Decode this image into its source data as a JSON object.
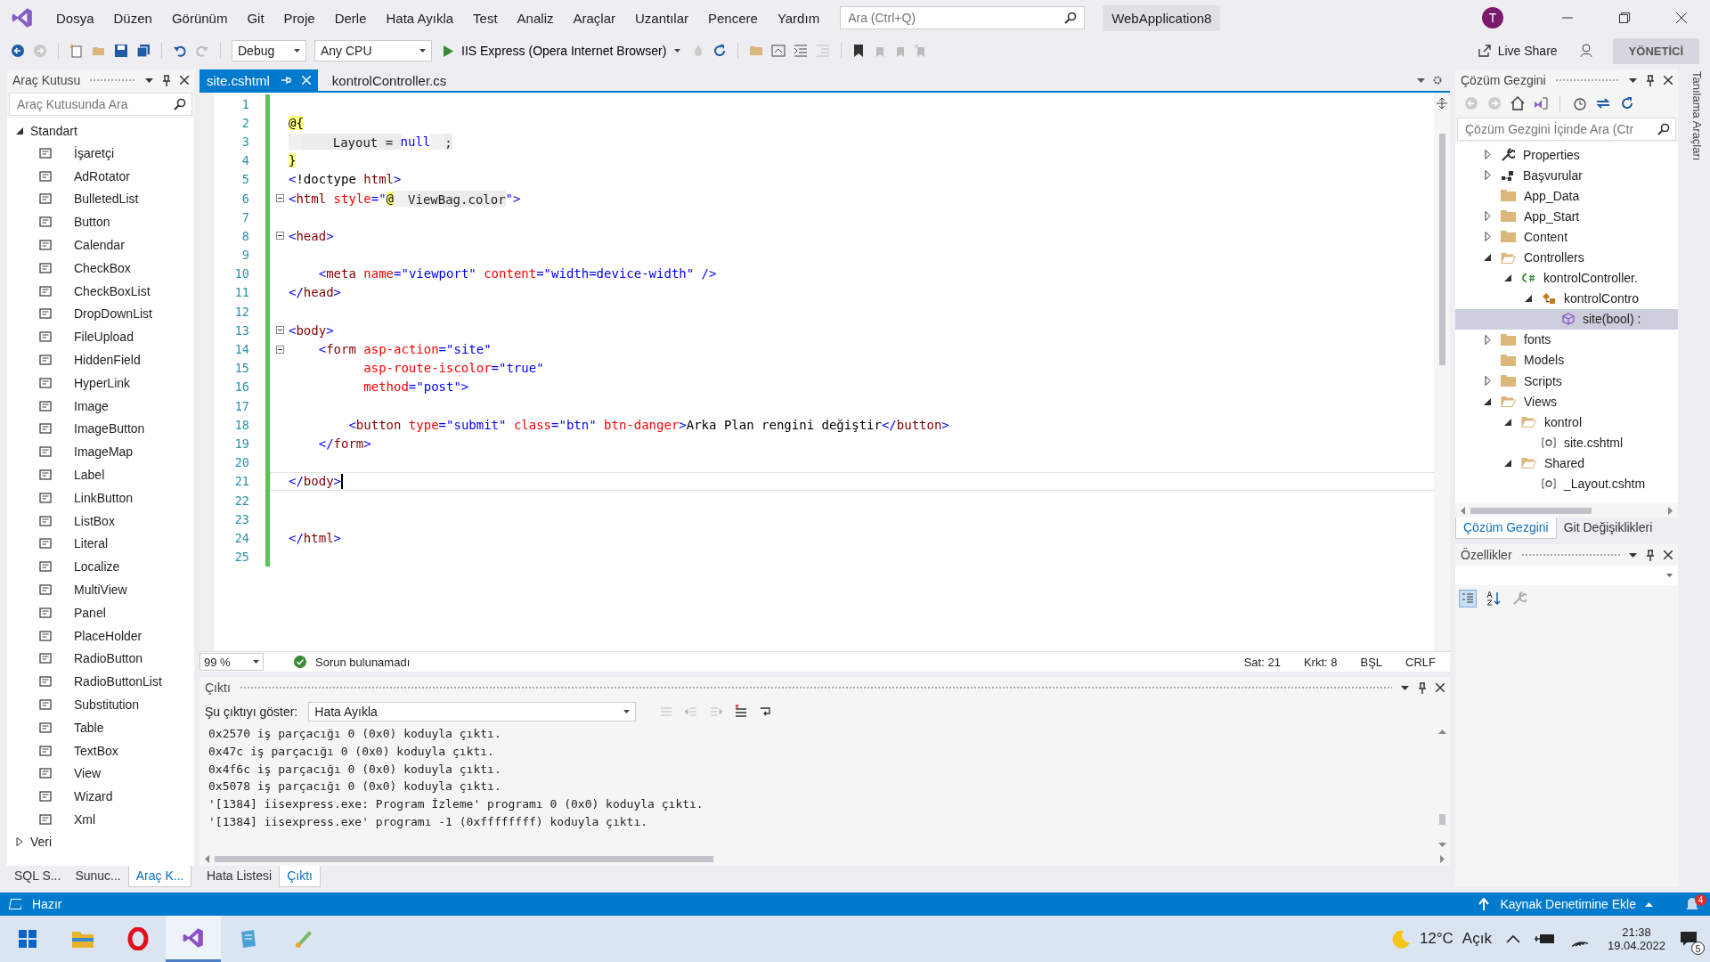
{
  "menu": [
    "Dosya",
    "Düzen",
    "Görünüm",
    "Git",
    "Proje",
    "Derle",
    "Hata Ayıkla",
    "Test",
    "Analiz",
    "Araçlar",
    "Uzantılar",
    "Pencere",
    "Yardım"
  ],
  "search": {
    "placeholder": "Ara (Ctrl+Q)"
  },
  "solution_name": "WebApplication8",
  "avatar": "T",
  "toolbar": {
    "configuration": "Debug",
    "platform": "Any CPU",
    "run": "IIS Express (Opera Internet Browser)",
    "live_share": "Live Share",
    "role": "YÖNETİCİ"
  },
  "toolbox": {
    "title": "Araç Kutusu",
    "placeholder": "Araç Kutusunda Ara",
    "groups": [
      {
        "label": "Standart",
        "expanded": true,
        "items": [
          "İşaretçi",
          "AdRotator",
          "BulletedList",
          "Button",
          "Calendar",
          "CheckBox",
          "CheckBoxList",
          "DropDownList",
          "FileUpload",
          "HiddenField",
          "HyperLink",
          "Image",
          "ImageButton",
          "ImageMap",
          "Label",
          "LinkButton",
          "ListBox",
          "Literal",
          "Localize",
          "MultiView",
          "Panel",
          "PlaceHolder",
          "RadioButton",
          "RadioButtonList",
          "Substitution",
          "Table",
          "TextBox",
          "View",
          "Wizard",
          "Xml"
        ]
      },
      {
        "label": "Veri",
        "expanded": false
      }
    ],
    "tabs": [
      {
        "label": "SQL S...",
        "selected": false
      },
      {
        "label": "Sunuc...",
        "selected": false
      },
      {
        "label": "Araç K...",
        "selected": true
      }
    ]
  },
  "editor": {
    "tabs": [
      {
        "label": "site.cshtml",
        "selected": true
      },
      {
        "label": "kontrolController.cs",
        "selected": false
      }
    ],
    "lines": [
      {
        "number": "1",
        "collapsible": false,
        "current": false
      },
      {
        "number": "2",
        "collapsible": false,
        "current": false,
        "tokens": [
          {
            "kind": "razor",
            "text": "@{"
          }
        ]
      },
      {
        "number": "3",
        "collapsible": false,
        "current": false,
        "tokens": [
          {
            "kind": "code",
            "text": "    Layout = "
          },
          {
            "kind": "keyword",
            "text": "null"
          },
          {
            "kind": "code",
            "text": ";"
          }
        ]
      },
      {
        "number": "4",
        "collapsible": false,
        "current": false,
        "tokens": [
          {
            "kind": "razor",
            "text": "}"
          }
        ]
      },
      {
        "number": "5",
        "collapsible": false,
        "current": false,
        "tokens": [
          {
            "kind": "punct",
            "text": "<"
          },
          {
            "kind": "plain",
            "text": "!doctype "
          },
          {
            "kind": "element",
            "text": "html"
          },
          {
            "kind": "punct",
            "text": ">"
          }
        ]
      },
      {
        "number": "6",
        "collapsible": true,
        "current": false,
        "tokens": [
          {
            "kind": "punct",
            "text": "<"
          },
          {
            "kind": "element",
            "text": "html"
          },
          {
            "kind": "attr",
            "text": " style"
          },
          {
            "kind": "punct",
            "text": "=\""
          },
          {
            "kind": "razor",
            "text": "@"
          },
          {
            "kind": "code",
            "text": "ViewBag.color"
          },
          {
            "kind": "punct",
            "text": "\">"
          }
        ]
      },
      {
        "number": "7",
        "collapsible": false,
        "current": false
      },
      {
        "number": "8",
        "collapsible": true,
        "current": false,
        "tokens": [
          {
            "kind": "punct",
            "text": "<"
          },
          {
            "kind": "element",
            "text": "head"
          },
          {
            "kind": "punct",
            "text": ">"
          }
        ]
      },
      {
        "number": "9",
        "collapsible": false,
        "current": false
      },
      {
        "number": "10",
        "collapsible": false,
        "current": false,
        "tokens": [
          {
            "kind": "punct",
            "text": "    <"
          },
          {
            "kind": "element",
            "text": "meta"
          },
          {
            "kind": "attr",
            "text": " name"
          },
          {
            "kind": "punct",
            "text": "=\"viewport\""
          },
          {
            "kind": "attr",
            "text": " content"
          },
          {
            "kind": "punct",
            "text": "=\"width=device-width\" />"
          }
        ]
      },
      {
        "number": "11",
        "collapsible": false,
        "current": false,
        "tokens": [
          {
            "kind": "punct",
            "text": "</"
          },
          {
            "kind": "element",
            "text": "head"
          },
          {
            "kind": "punct",
            "text": ">"
          }
        ]
      },
      {
        "number": "12",
        "collapsible": false,
        "current": false
      },
      {
        "number": "13",
        "collapsible": true,
        "current": false,
        "tokens": [
          {
            "kind": "punct",
            "text": "<"
          },
          {
            "kind": "element",
            "text": "body"
          },
          {
            "kind": "punct",
            "text": ">"
          }
        ]
      },
      {
        "number": "14",
        "collapsible": true,
        "current": false,
        "tokens": [
          {
            "kind": "punct",
            "text": "    <"
          },
          {
            "kind": "element",
            "text": "form"
          },
          {
            "kind": "attr",
            "text": " asp-action"
          },
          {
            "kind": "punct",
            "text": "=\"site\""
          }
        ]
      },
      {
        "number": "15",
        "collapsible": false,
        "current": false,
        "tokens": [
          {
            "kind": "attr",
            "text": "          asp-route-iscolor"
          },
          {
            "kind": "punct",
            "text": "=\"true\""
          }
        ]
      },
      {
        "number": "16",
        "collapsible": false,
        "current": false,
        "tokens": [
          {
            "kind": "attr",
            "text": "          method"
          },
          {
            "kind": "punct",
            "text": "=\"post\">"
          }
        ]
      },
      {
        "number": "17",
        "collapsible": false,
        "current": false
      },
      {
        "number": "18",
        "collapsible": false,
        "current": false,
        "tokens": [
          {
            "kind": "punct",
            "text": "        <"
          },
          {
            "kind": "element",
            "text": "button"
          },
          {
            "kind": "attr",
            "text": " type"
          },
          {
            "kind": "punct",
            "text": "=\"submit\""
          },
          {
            "kind": "attr",
            "text": " class"
          },
          {
            "kind": "punct",
            "text": "=\"btn\""
          },
          {
            "kind": "attr",
            "text": " btn-danger"
          },
          {
            "kind": "punct",
            "text": ">"
          },
          {
            "kind": "plain",
            "text": "Arka Plan rengini değiştir"
          },
          {
            "kind": "punct",
            "text": "</"
          },
          {
            "kind": "element",
            "text": "button"
          },
          {
            "kind": "punct",
            "text": ">"
          }
        ]
      },
      {
        "number": "19",
        "collapsible": false,
        "current": false,
        "tokens": [
          {
            "kind": "punct",
            "text": "    </"
          },
          {
            "kind": "element",
            "text": "form"
          },
          {
            "kind": "punct",
            "text": ">"
          }
        ]
      },
      {
        "number": "20",
        "collapsible": false,
        "current": false
      },
      {
        "number": "21",
        "collapsible": false,
        "current": true,
        "tokens": [
          {
            "kind": "punct",
            "text": "</"
          },
          {
            "kind": "element",
            "text": "body"
          },
          {
            "kind": "punct",
            "text": ">"
          }
        ]
      },
      {
        "number": "22",
        "collapsible": false,
        "current": false
      },
      {
        "number": "23",
        "collapsible": false,
        "current": false
      },
      {
        "number": "24",
        "collapsible": false,
        "current": false,
        "tokens": [
          {
            "kind": "punct",
            "text": "</"
          },
          {
            "kind": "element",
            "text": "html"
          },
          {
            "kind": "punct",
            "text": ">"
          }
        ]
      },
      {
        "number": "25",
        "collapsible": false,
        "current": false
      }
    ],
    "status": {
      "zoom": "99 %",
      "issues": "Sorun bulunamadı",
      "line": "Sat: 21",
      "column": "Krkt: 8",
      "indent": "BŞL",
      "line_ending": "CRLF"
    }
  },
  "output": {
    "title": "Çıktı",
    "show_label": "Şu çıktıyı göster:",
    "source": "Hata Ayıkla",
    "lines": [
      "0x2570 iş parçacığı 0 (0x0) koduyla çıktı.",
      "0x47c iş parçacığı 0 (0x0) koduyla çıktı.",
      "0x4f6c iş parçacığı 0 (0x0) koduyla çıktı.",
      "0x5078 iş parçacığı 0 (0x0) koduyla çıktı.",
      "'[1384] iisexpress.exe: Program İzleme' programı 0 (0x0) koduyla çıktı.",
      "'[1384] iisexpress.exe' programı -1 (0xffffffff) koduyla çıktı."
    ],
    "tabs": [
      {
        "label": "Hata Listesi",
        "selected": false
      },
      {
        "label": "Çıktı",
        "selected": true
      }
    ]
  },
  "solution_explorer": {
    "title": "Çözüm Gezgini",
    "placeholder": "Çözüm Gezgini İçinde Ara (Ctr",
    "items": [
      {
        "label": "Properties",
        "kind": "wrench",
        "expanded": false,
        "selected": false
      },
      {
        "label": "Başvurular",
        "kind": "references",
        "expanded": false,
        "selected": false
      },
      {
        "label": "App_Data",
        "kind": "folder",
        "selected": false
      },
      {
        "label": "App_Start",
        "kind": "folder",
        "expanded": false,
        "selected": false
      },
      {
        "label": "Content",
        "kind": "folder",
        "expanded": false,
        "selected": false
      },
      {
        "label": "Controllers",
        "kind": "folder",
        "expanded": true,
        "selected": false,
        "children": [
          {
            "label": "kontrolController.",
            "kind": "csharp",
            "expanded": true,
            "selected": false,
            "children": [
              {
                "label": "kontrolContro",
                "kind": "class",
                "expanded": true,
                "selected": false,
                "children": [
                  {
                    "label": "site(bool) :",
                    "kind": "method",
                    "selected": true
                  }
                ]
              }
            ]
          }
        ]
      },
      {
        "label": "fonts",
        "kind": "folder",
        "expanded": false,
        "selected": false
      },
      {
        "label": "Models",
        "kind": "folder",
        "selected": false
      },
      {
        "label": "Scripts",
        "kind": "folder",
        "expanded": false,
        "selected": false
      },
      {
        "label": "Views",
        "kind": "folder",
        "expanded": true,
        "selected": false,
        "children": [
          {
            "label": "kontrol",
            "kind": "folder",
            "expanded": true,
            "selected": false,
            "children": [
              {
                "label": "site.cshtml",
                "kind": "razor",
                "selected": false
              }
            ]
          },
          {
            "label": "Shared",
            "kind": "folder",
            "expanded": true,
            "selected": false,
            "children": [
              {
                "label": "_Layout.cshtm",
                "kind": "razor",
                "selected": false
              }
            ]
          }
        ]
      }
    ],
    "tabs": [
      {
        "label": "Çözüm Gezgini",
        "selected": true
      },
      {
        "label": "Git Değişiklikleri",
        "selected": false
      }
    ]
  },
  "properties": {
    "title": "Özellikler"
  },
  "side_strip": "Tanılama Araçları",
  "status_bar": {
    "state": "Hazır",
    "source_control": "Kaynak Denetimine Ekle",
    "notifications": "4"
  },
  "taskbar": {
    "apps": [
      {
        "kind": "windows",
        "active": false
      },
      {
        "kind": "explorer",
        "active": false
      },
      {
        "kind": "opera",
        "active": false
      },
      {
        "kind": "vs",
        "active": true
      },
      {
        "kind": "app",
        "active": false
      },
      {
        "kind": "paint",
        "active": false
      }
    ],
    "temperature": "12°C",
    "weather": "Açık",
    "time": "21:38",
    "date": "19.04.2022",
    "notifications": "5"
  }
}
